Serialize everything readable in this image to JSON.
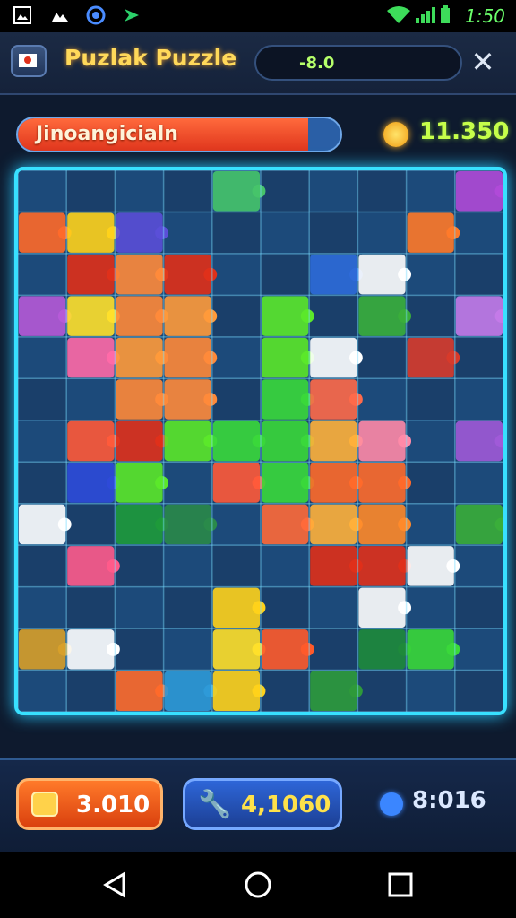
{
  "status_bar": {
    "time": "1:50",
    "left_icons": [
      "image-icon",
      "gallery-icon",
      "sync-icon",
      "app-icon"
    ],
    "right_icons": [
      "wifi-icon",
      "signal-icon",
      "battery-icon"
    ]
  },
  "header": {
    "title": "Puzlak Puzzle",
    "score_display": "-8.0",
    "flag_icon": "flag-icon",
    "close_icon": "close-icon"
  },
  "progress": {
    "label": "Jinoangicialn",
    "fill_fraction": 0.9
  },
  "coins": {
    "icon": "coin-icon",
    "value": "11.350"
  },
  "board": {
    "columns": 10,
    "rows": 12,
    "tiles": [
      {
        "col": 0,
        "row": 1,
        "color": "#ff6a2a"
      },
      {
        "col": 1,
        "row": 1,
        "color": "#ffd21a"
      },
      {
        "col": 2,
        "row": 1,
        "color": "#5a4fd8"
      },
      {
        "col": 4,
        "row": 0,
        "color": "#46c46a"
      },
      {
        "col": 8,
        "row": 1,
        "color": "#ff7a2a"
      },
      {
        "col": 9,
        "row": 0,
        "color": "#b04ad8"
      },
      {
        "col": 0,
        "row": 3,
        "color": "#b65ad8"
      },
      {
        "col": 1,
        "row": 2,
        "color": "#e0301a"
      },
      {
        "col": 1,
        "row": 3,
        "color": "#ffe02a"
      },
      {
        "col": 2,
        "row": 2,
        "color": "#ff8a3a"
      },
      {
        "col": 2,
        "row": 3,
        "color": "#ff8a3a"
      },
      {
        "col": 3,
        "row": 2,
        "color": "#e0301a"
      },
      {
        "col": 3,
        "row": 3,
        "color": "#ff9a3a"
      },
      {
        "col": 5,
        "row": 3,
        "color": "#5be82a"
      },
      {
        "col": 5,
        "row": 4,
        "color": "#5be82a"
      },
      {
        "col": 6,
        "row": 2,
        "color": "#2e6ad8"
      },
      {
        "col": 7,
        "row": 2,
        "color": "#ffffff"
      },
      {
        "col": 7,
        "row": 3,
        "color": "#3aae3a"
      },
      {
        "col": 8,
        "row": 4,
        "color": "#d83a2a"
      },
      {
        "col": 9,
        "row": 3,
        "color": "#c47ae8"
      },
      {
        "col": 1,
        "row": 4,
        "color": "#ff6aa8"
      },
      {
        "col": 2,
        "row": 4,
        "color": "#ff9a3a"
      },
      {
        "col": 3,
        "row": 4,
        "color": "#ff8a3a"
      },
      {
        "col": 6,
        "row": 4,
        "color": "#ffffff"
      },
      {
        "col": 2,
        "row": 5,
        "color": "#ff8a3a"
      },
      {
        "col": 3,
        "row": 5,
        "color": "#ff8a3a"
      },
      {
        "col": 5,
        "row": 5,
        "color": "#3ad83a"
      },
      {
        "col": 6,
        "row": 5,
        "color": "#ff6a4a"
      },
      {
        "col": 1,
        "row": 6,
        "color": "#ff5a3a"
      },
      {
        "col": 2,
        "row": 6,
        "color": "#e0301a"
      },
      {
        "col": 3,
        "row": 6,
        "color": "#5be82a"
      },
      {
        "col": 4,
        "row": 6,
        "color": "#3ad83a"
      },
      {
        "col": 5,
        "row": 6,
        "color": "#3ad83a"
      },
      {
        "col": 6,
        "row": 6,
        "color": "#ffb03a"
      },
      {
        "col": 7,
        "row": 6,
        "color": "#ff8aa8"
      },
      {
        "col": 9,
        "row": 6,
        "color": "#a05ad8"
      },
      {
        "col": 1,
        "row": 7,
        "color": "#2e4ad8"
      },
      {
        "col": 2,
        "row": 7,
        "color": "#5be82a"
      },
      {
        "col": 4,
        "row": 7,
        "color": "#ff5a3a"
      },
      {
        "col": 5,
        "row": 7,
        "color": "#3ad83a"
      },
      {
        "col": 6,
        "row": 7,
        "color": "#ff6a2a"
      },
      {
        "col": 7,
        "row": 7,
        "color": "#ff6a2a"
      },
      {
        "col": 0,
        "row": 8,
        "color": "#ffffff"
      },
      {
        "col": 2,
        "row": 8,
        "color": "#1e9a3a"
      },
      {
        "col": 3,
        "row": 8,
        "color": "#2a8a4a"
      },
      {
        "col": 5,
        "row": 8,
        "color": "#ff6a3a"
      },
      {
        "col": 6,
        "row": 8,
        "color": "#ffb03a"
      },
      {
        "col": 7,
        "row": 8,
        "color": "#ff8a2a"
      },
      {
        "col": 9,
        "row": 8,
        "color": "#3aae3a"
      },
      {
        "col": 1,
        "row": 9,
        "color": "#ff5a8a"
      },
      {
        "col": 6,
        "row": 9,
        "color": "#e0301a"
      },
      {
        "col": 7,
        "row": 9,
        "color": "#e0301a"
      },
      {
        "col": 8,
        "row": 9,
        "color": "#ffffff"
      },
      {
        "col": 4,
        "row": 10,
        "color": "#ffd21a"
      },
      {
        "col": 7,
        "row": 10,
        "color": "#ffffff"
      },
      {
        "col": 0,
        "row": 11,
        "color": "#d8a02a"
      },
      {
        "col": 1,
        "row": 11,
        "color": "#ffffff"
      },
      {
        "col": 4,
        "row": 11,
        "color": "#ffe02a"
      },
      {
        "col": 5,
        "row": 11,
        "color": "#ff5a2a"
      },
      {
        "col": 7,
        "row": 11,
        "color": "#1e8a3a"
      },
      {
        "col": 8,
        "row": 11,
        "color": "#3ad83a"
      },
      {
        "col": 2,
        "row": 12,
        "color": "#ff6a2a"
      },
      {
        "col": 3,
        "row": 12,
        "color": "#2e9ad8"
      },
      {
        "col": 4,
        "row": 12,
        "color": "#ffd21a"
      },
      {
        "col": 6,
        "row": 12,
        "color": "#2e9a3a"
      }
    ]
  },
  "footer": {
    "moves": {
      "icon": "moves-icon",
      "value": "3.010"
    },
    "tool": {
      "icon": "wrench-icon",
      "value": "4,1060"
    },
    "timer": {
      "icon": "gear-icon",
      "value": "8:016"
    }
  },
  "nav_bar": {
    "icons": [
      "back-icon",
      "home-icon",
      "recents-icon"
    ]
  },
  "colors": {
    "board_border": "#38e0ff",
    "accent_orange": "#ff6a2a",
    "accent_green": "#c6ff4a",
    "title_yellow": "#ffd95a"
  }
}
